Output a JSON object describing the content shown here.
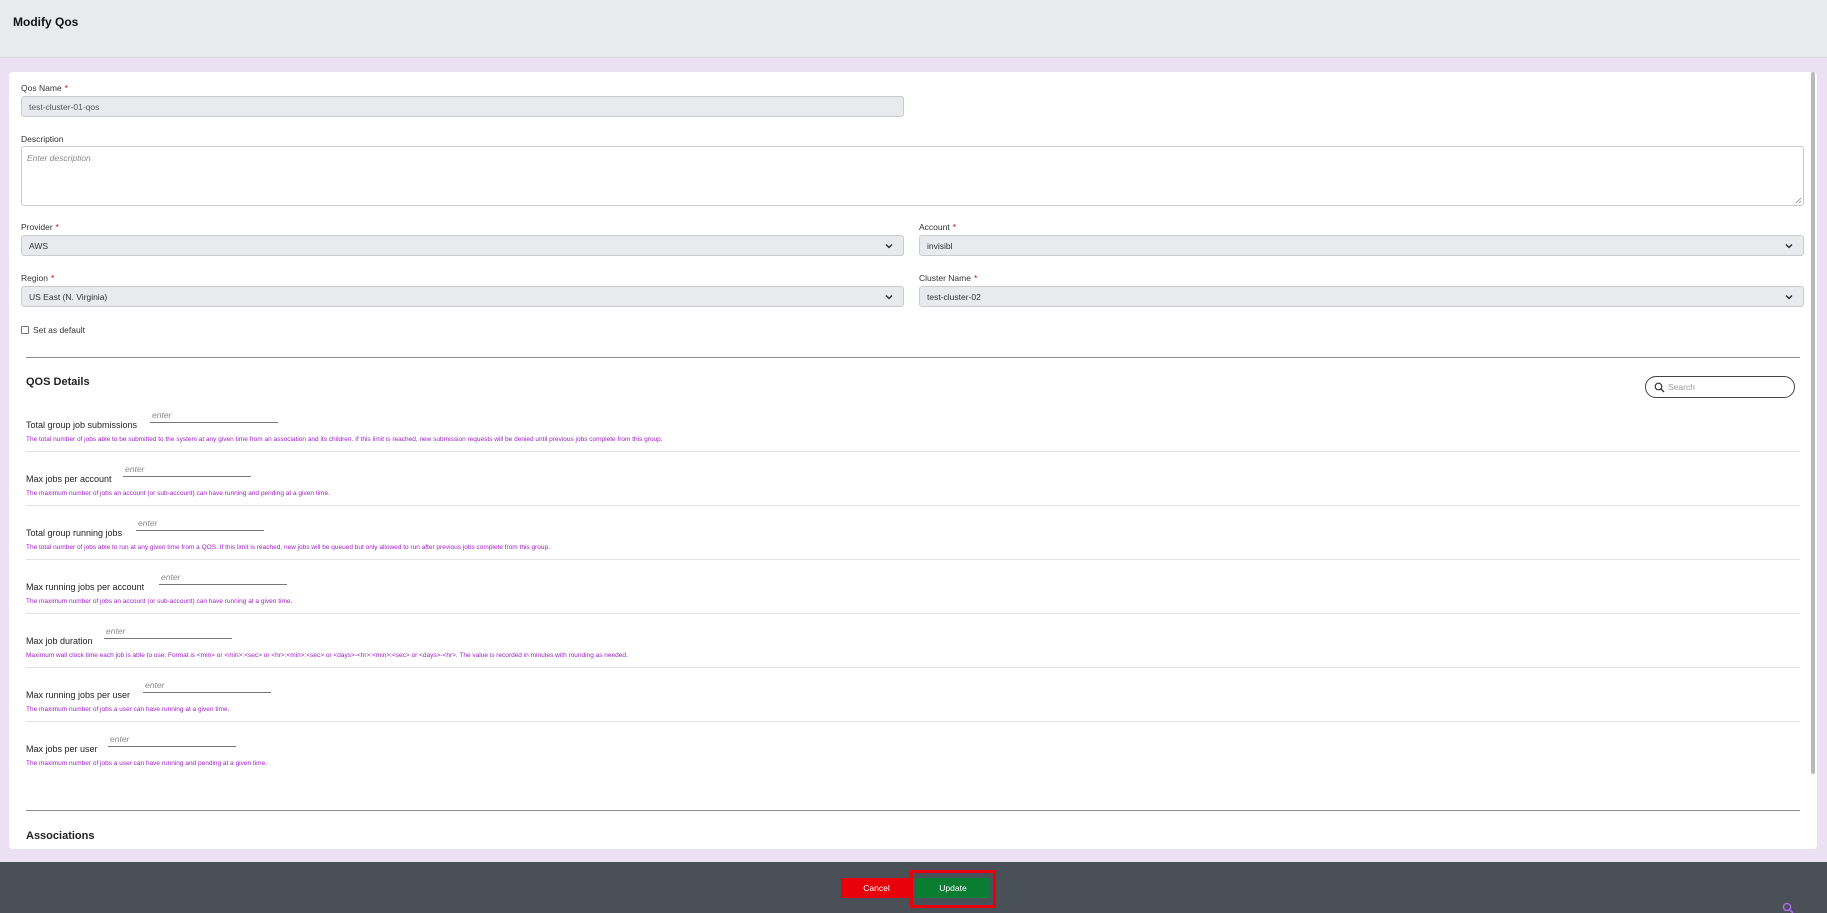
{
  "header": {
    "title": "Modify Qos"
  },
  "form": {
    "qos_name": {
      "label": "Qos Name",
      "required_mark": "*",
      "value": "test-cluster-01-qos"
    },
    "description": {
      "label": "Description",
      "placeholder": "Enter description"
    },
    "provider": {
      "label": "Provider",
      "required_mark": "*",
      "value": "AWS"
    },
    "account": {
      "label": "Account",
      "required_mark": "*",
      "value": "invisibl"
    },
    "region": {
      "label": "Region",
      "required_mark": "*",
      "value": "US East (N. Virginia)"
    },
    "cluster_name": {
      "label": "Cluster Name",
      "required_mark": "*",
      "value": "test-cluster-02"
    },
    "set_default": {
      "label": "Set as default",
      "checked": false
    }
  },
  "qos_details": {
    "title": "QOS Details",
    "search_placeholder": "Search",
    "input_placeholder": "enter",
    "rows": [
      {
        "name": "Total group job submissions",
        "help": "The total number of jobs able to be submitted to the system at any given time from an association and its children. If this limit is reached, new submission requests will be denied until previous jobs complete from this group."
      },
      {
        "name": "Max jobs per account",
        "help": "The maximum number of jobs an account (or sub-account) can have running and pending at a given time."
      },
      {
        "name": "Total group running jobs",
        "help": "The total number of jobs able to run at any given time from a QOS. If this limit is reached, new jobs will be queued but only allowed to run after previous jobs complete from this group."
      },
      {
        "name": "Max running jobs per account",
        "help": "The maximum number of jobs an account (or sub-account) can have running at a given time."
      },
      {
        "name": "Max job duration",
        "help": "Maximum wall clock time each job is able to use. Format is <min> or <min>:<sec> or <hr>:<min>:<sec> or <days>-<hr>:<min>:<sec> or <days>-<hr>. The value is recorded in minutes with rounding as needed."
      },
      {
        "name": "Max running jobs per user",
        "help": "The maximum number of jobs a user can have running at a given time."
      },
      {
        "name": "Max jobs per user",
        "help": "The maximum number of jobs a user can have running and pending at a given time."
      }
    ]
  },
  "associations": {
    "title": "Associations"
  },
  "footer": {
    "cancel_label": "Cancel",
    "update_label": "Update"
  },
  "colors": {
    "accent_help": "#a020c8",
    "cancel": "#e8000b",
    "update": "#0a7d33",
    "footer_bg": "#4a5058"
  },
  "icons": {
    "search": "search-icon",
    "chevron": "chevron-down-icon",
    "zoom": "zoom-icon"
  }
}
